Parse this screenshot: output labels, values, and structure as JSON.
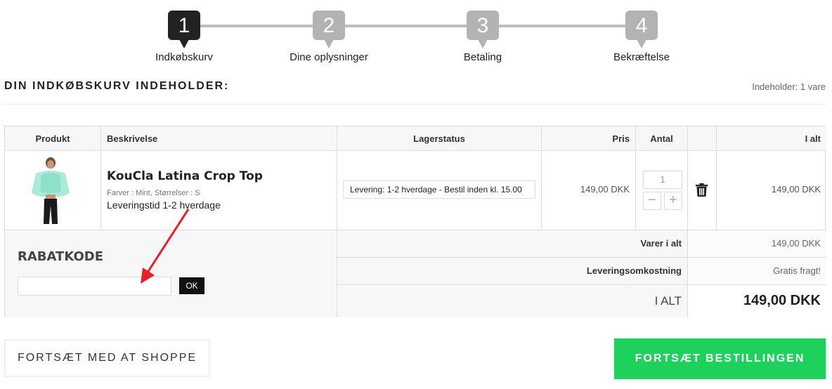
{
  "steps": [
    {
      "num": "1",
      "label": "Indkøbskurv",
      "active": true
    },
    {
      "num": "2",
      "label": "Dine oplysninger",
      "active": false
    },
    {
      "num": "3",
      "label": "Betaling",
      "active": false
    },
    {
      "num": "4",
      "label": "Bekræftelse",
      "active": false
    }
  ],
  "cart": {
    "title": "DIN INDKØBSKURV INDEHOLDER:",
    "count": "Indeholder: 1 vare"
  },
  "table": {
    "headers": {
      "product": "Produkt",
      "description": "Beskrivelse",
      "stock": "Lagerstatus",
      "price": "Pris",
      "qty": "Antal",
      "total": "I alt"
    },
    "items": [
      {
        "name": "KouCla Latina Crop Top",
        "variant": "Farver : Mint, Størrelser : S",
        "delivery": "Leveringstid 1-2 hverdage",
        "stock": "Levering: 1-2 hverdage - Bestil inden kl. 15.00",
        "price": "149,00 DKK",
        "qty": "1",
        "total": "149,00 DKK"
      }
    ]
  },
  "discount": {
    "title": "RABATKODE",
    "value": "",
    "ok_label": "OK"
  },
  "summary": {
    "subtotal_label": "Varer i alt",
    "subtotal_value": "149,00 DKK",
    "shipping_label": "Leveringsomkostning",
    "shipping_value": "Gratis fragt!",
    "total_label": "I ALT",
    "total_value": "149,00 DKK"
  },
  "buttons": {
    "continue_shopping": "FORTSÆT MED AT SHOPPE",
    "continue_order": "FORTSÆT BESTILLINGEN"
  },
  "colors": {
    "accent_green": "#1ed05c",
    "arrow_red": "#e8202a",
    "step_active": "#222222",
    "step_inactive": "#b3b3b3"
  }
}
